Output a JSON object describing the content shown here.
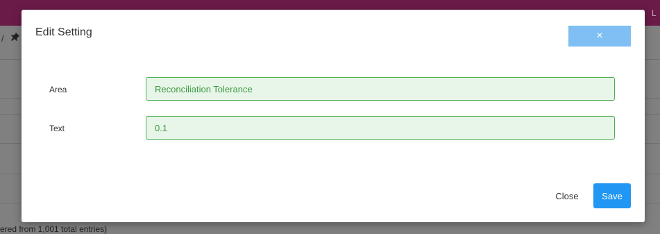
{
  "background": {
    "topbar_user_initial": "L",
    "footer_text": "ered from 1,001 total entries)"
  },
  "colors": {
    "topbar": "#6b1b48",
    "accent_blue": "#2196f3",
    "close_x_button": "#7fbff3",
    "valid_field_border": "#4caf50",
    "valid_field_bg": "#e8f5e9",
    "valid_field_text": "#3d9a40"
  },
  "modal": {
    "title": "Edit Setting",
    "close_icon": "×",
    "fields": {
      "area": {
        "label": "Area",
        "value": "Reconciliation Tolerance"
      },
      "text": {
        "label": "Text",
        "value": "0.1"
      }
    },
    "footer": {
      "close_label": "Close",
      "save_label": "Save"
    }
  }
}
